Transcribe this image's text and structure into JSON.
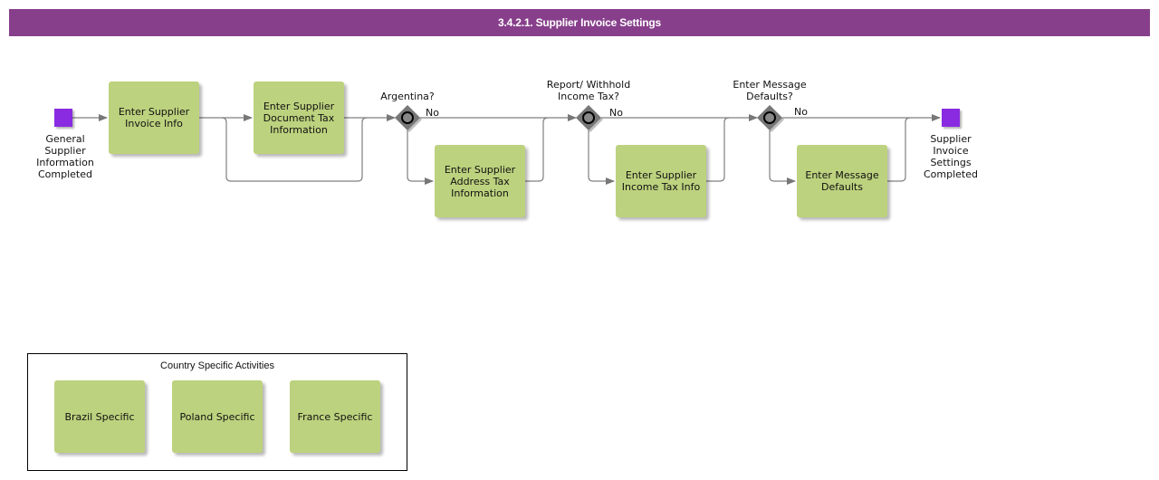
{
  "header": {
    "title": "3.4.2.1. Supplier Invoice Settings"
  },
  "colors": {
    "header": "#873f8b",
    "task": "#bdd27e",
    "event": "#8a2be2",
    "gateway": "#777777"
  },
  "events": {
    "start": {
      "label": "General\nSupplier\nInformation\nCompleted"
    },
    "end": {
      "label": "Supplier\nInvoice\nSettings\nCompleted"
    }
  },
  "tasks": {
    "invoice_info": "Enter Supplier\nInvoice Info",
    "document_tax": "Enter Supplier\nDocument Tax\nInformation",
    "address_tax": "Enter Supplier\nAddress Tax\nInformation",
    "income_tax": "Enter Supplier\nIncome Tax Info",
    "message_defaults": "Enter Message\nDefaults"
  },
  "gateways": {
    "argentina": {
      "question": "Argentina?",
      "no_label": "No"
    },
    "income_tax": {
      "question": "Report/ Withhold\nIncome Tax?",
      "no_label": "No"
    },
    "message": {
      "question": "Enter Message\nDefaults?",
      "no_label": "No"
    }
  },
  "legend": {
    "title": "Country Specific Activities",
    "items": [
      "Brazil Specific",
      "Poland Specific",
      "France Specific"
    ]
  }
}
